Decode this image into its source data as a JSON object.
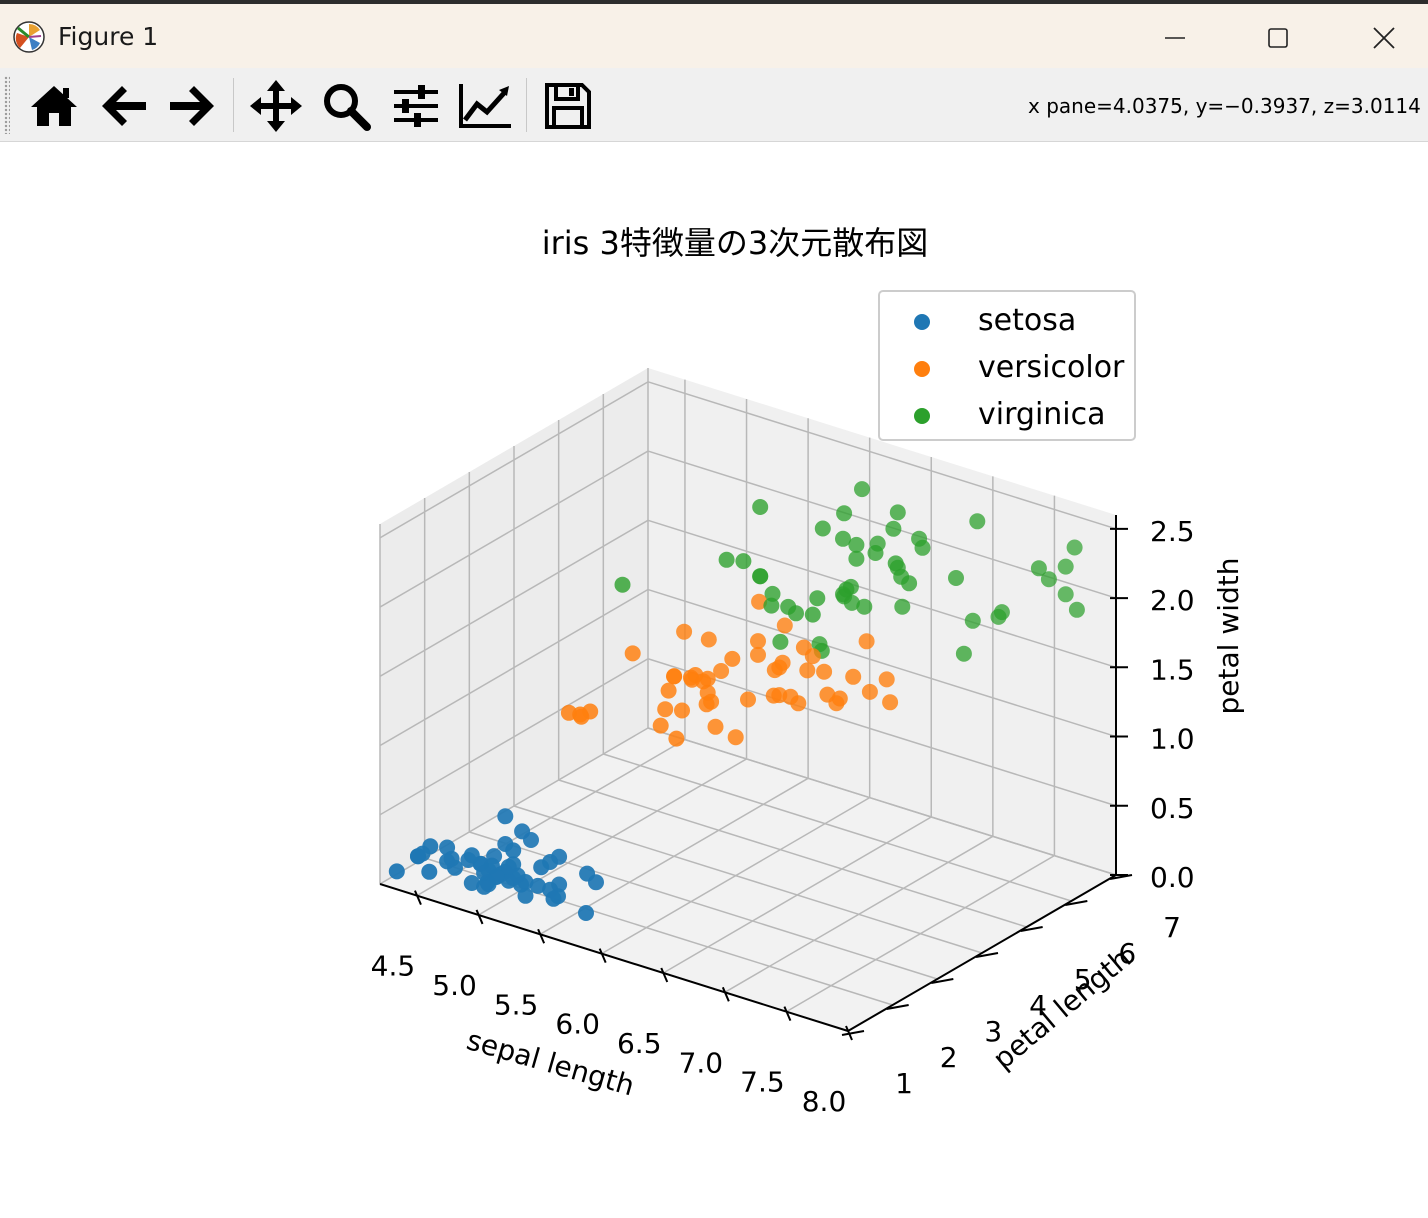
{
  "window": {
    "title": "Figure 1"
  },
  "icons": {
    "app": "matplotlib-logo-icon",
    "minimize": "minimize-icon",
    "maximize": "maximize-icon",
    "close": "close-icon"
  },
  "toolbar": {
    "buttons": [
      {
        "icon": "home-icon"
      },
      {
        "icon": "back-arrow-icon"
      },
      {
        "icon": "forward-arrow-icon"
      },
      {
        "icon": "pan-icon"
      },
      {
        "icon": "zoom-icon"
      },
      {
        "icon": "subplots-config-icon"
      },
      {
        "icon": "edit-axes-icon"
      },
      {
        "icon": "save-icon"
      }
    ],
    "coords": "x pane=4.0375, y=−0.3937, z=3.0114"
  },
  "chart_data": {
    "type": "scatter",
    "projection": "3d",
    "title": "iris 3特徴量の3次元散布図",
    "xlabel": "sepal length",
    "ylabel": "petal length",
    "zlabel": "petal width",
    "xlim": [
      4.2,
      8.0
    ],
    "ylim": [
      1.0,
      7.0
    ],
    "zlim": [
      0.0,
      2.6
    ],
    "xticks": [
      "4.5",
      "5.0",
      "5.5",
      "6.0",
      "6.5",
      "7.0",
      "7.5",
      "8.0"
    ],
    "yticks": [
      "1",
      "2",
      "3",
      "4",
      "5",
      "6",
      "7"
    ],
    "zticks": [
      "0.0",
      "0.5",
      "1.0",
      "1.5",
      "2.0",
      "2.5"
    ],
    "grid": true,
    "legend_position": "top-right",
    "series": [
      {
        "name": "setosa",
        "color": "#1f77b4",
        "points": [
          [
            5.1,
            1.4,
            0.2
          ],
          [
            4.9,
            1.4,
            0.2
          ],
          [
            4.7,
            1.3,
            0.2
          ],
          [
            4.6,
            1.5,
            0.2
          ],
          [
            5.0,
            1.4,
            0.2
          ],
          [
            5.4,
            1.7,
            0.4
          ],
          [
            4.6,
            1.4,
            0.3
          ],
          [
            5.0,
            1.5,
            0.2
          ],
          [
            4.4,
            1.4,
            0.2
          ],
          [
            4.9,
            1.5,
            0.1
          ],
          [
            5.4,
            1.5,
            0.2
          ],
          [
            4.8,
            1.6,
            0.2
          ],
          [
            4.8,
            1.4,
            0.1
          ],
          [
            4.3,
            1.1,
            0.1
          ],
          [
            5.8,
            1.2,
            0.2
          ],
          [
            5.7,
            1.5,
            0.4
          ],
          [
            5.4,
            1.3,
            0.4
          ],
          [
            5.1,
            1.4,
            0.3
          ],
          [
            5.7,
            1.7,
            0.3
          ],
          [
            5.1,
            1.5,
            0.3
          ],
          [
            5.4,
            1.7,
            0.2
          ],
          [
            5.1,
            1.5,
            0.4
          ],
          [
            4.6,
            1.0,
            0.2
          ],
          [
            5.1,
            1.7,
            0.5
          ],
          [
            4.8,
            1.9,
            0.2
          ],
          [
            5.0,
            1.6,
            0.2
          ],
          [
            5.0,
            1.6,
            0.4
          ],
          [
            5.2,
            1.5,
            0.2
          ],
          [
            5.2,
            1.4,
            0.2
          ],
          [
            4.7,
            1.6,
            0.2
          ],
          [
            4.8,
            1.6,
            0.2
          ],
          [
            5.4,
            1.5,
            0.4
          ],
          [
            5.2,
            1.5,
            0.1
          ],
          [
            5.5,
            1.4,
            0.2
          ],
          [
            4.9,
            1.5,
            0.2
          ],
          [
            5.0,
            1.2,
            0.2
          ],
          [
            5.5,
            1.3,
            0.2
          ],
          [
            4.9,
            1.4,
            0.1
          ],
          [
            4.4,
            1.3,
            0.2
          ],
          [
            5.1,
            1.5,
            0.2
          ],
          [
            5.0,
            1.3,
            0.3
          ],
          [
            4.5,
            1.3,
            0.3
          ],
          [
            4.4,
            1.3,
            0.2
          ],
          [
            5.0,
            1.6,
            0.6
          ],
          [
            5.1,
            1.9,
            0.4
          ],
          [
            4.8,
            1.4,
            0.3
          ],
          [
            5.1,
            1.6,
            0.2
          ],
          [
            4.6,
            1.4,
            0.2
          ],
          [
            5.3,
            1.5,
            0.2
          ],
          [
            5.0,
            1.4,
            0.2
          ]
        ]
      },
      {
        "name": "versicolor",
        "color": "#ff7f0e",
        "points": [
          [
            7.0,
            4.7,
            1.4
          ],
          [
            6.4,
            4.5,
            1.5
          ],
          [
            6.9,
            4.9,
            1.5
          ],
          [
            5.5,
            4.0,
            1.3
          ],
          [
            6.5,
            4.6,
            1.5
          ],
          [
            5.7,
            4.5,
            1.3
          ],
          [
            6.3,
            4.7,
            1.6
          ],
          [
            4.9,
            3.3,
            1.0
          ],
          [
            6.6,
            4.6,
            1.3
          ],
          [
            5.2,
            3.9,
            1.4
          ],
          [
            5.0,
            3.5,
            1.0
          ],
          [
            5.9,
            4.2,
            1.5
          ],
          [
            6.0,
            4.0,
            1.0
          ],
          [
            6.1,
            4.7,
            1.4
          ],
          [
            5.6,
            3.6,
            1.3
          ],
          [
            6.7,
            4.4,
            1.4
          ],
          [
            5.6,
            4.5,
            1.5
          ],
          [
            5.8,
            4.1,
            1.0
          ],
          [
            6.2,
            4.5,
            1.5
          ],
          [
            5.6,
            3.9,
            1.1
          ],
          [
            5.9,
            4.8,
            1.8
          ],
          [
            6.1,
            4.0,
            1.3
          ],
          [
            6.3,
            4.9,
            1.5
          ],
          [
            6.1,
            4.7,
            1.2
          ],
          [
            6.4,
            4.3,
            1.3
          ],
          [
            6.6,
            4.4,
            1.4
          ],
          [
            6.8,
            4.8,
            1.4
          ],
          [
            6.7,
            5.0,
            1.7
          ],
          [
            6.0,
            4.5,
            1.5
          ],
          [
            5.7,
            3.5,
            1.0
          ],
          [
            5.5,
            3.8,
            1.1
          ],
          [
            5.5,
            3.7,
            1.0
          ],
          [
            5.8,
            3.9,
            1.2
          ],
          [
            6.0,
            5.1,
            1.6
          ],
          [
            5.4,
            4.5,
            1.5
          ],
          [
            6.0,
            4.5,
            1.6
          ],
          [
            6.7,
            4.7,
            1.5
          ],
          [
            6.3,
            4.4,
            1.3
          ],
          [
            5.6,
            4.1,
            1.3
          ],
          [
            5.5,
            4.0,
            1.3
          ],
          [
            5.5,
            4.4,
            1.2
          ],
          [
            6.1,
            4.6,
            1.4
          ],
          [
            5.8,
            4.0,
            1.2
          ],
          [
            5.0,
            3.3,
            1.0
          ],
          [
            5.6,
            4.2,
            1.3
          ],
          [
            5.7,
            4.2,
            1.2
          ],
          [
            5.7,
            4.2,
            1.3
          ],
          [
            6.2,
            4.3,
            1.3
          ],
          [
            5.1,
            3.0,
            1.1
          ],
          [
            5.7,
            4.1,
            1.3
          ]
        ]
      },
      {
        "name": "virginica",
        "color": "#2ca02c",
        "points": [
          [
            6.3,
            6.0,
            2.5
          ],
          [
            5.8,
            5.1,
            1.9
          ],
          [
            7.1,
            5.9,
            2.1
          ],
          [
            6.3,
            5.6,
            1.8
          ],
          [
            6.5,
            5.8,
            2.2
          ],
          [
            7.6,
            6.6,
            2.1
          ],
          [
            4.9,
            4.5,
            1.7
          ],
          [
            7.3,
            6.3,
            1.8
          ],
          [
            6.7,
            5.8,
            1.8
          ],
          [
            7.2,
            6.1,
            2.5
          ],
          [
            6.5,
            5.1,
            2.0
          ],
          [
            6.4,
            5.3,
            1.9
          ],
          [
            6.8,
            5.5,
            2.1
          ],
          [
            5.7,
            5.0,
            2.0
          ],
          [
            5.8,
            5.1,
            2.4
          ],
          [
            6.4,
            5.3,
            2.3
          ],
          [
            6.5,
            5.5,
            1.8
          ],
          [
            7.7,
            6.7,
            2.2
          ],
          [
            7.7,
            6.9,
            2.3
          ],
          [
            6.0,
            5.0,
            1.5
          ],
          [
            6.9,
            5.7,
            2.3
          ],
          [
            5.6,
            4.9,
            2.0
          ],
          [
            7.7,
            6.7,
            2.0
          ],
          [
            6.3,
            4.9,
            1.8
          ],
          [
            6.7,
            5.7,
            2.1
          ],
          [
            7.2,
            6.0,
            1.8
          ],
          [
            6.2,
            4.8,
            1.8
          ],
          [
            6.1,
            4.9,
            1.8
          ],
          [
            6.4,
            5.6,
            2.1
          ],
          [
            7.2,
            5.8,
            1.6
          ],
          [
            7.4,
            6.1,
            1.9
          ],
          [
            7.9,
            6.4,
            2.0
          ],
          [
            6.4,
            5.6,
            2.2
          ],
          [
            6.3,
            5.1,
            1.5
          ],
          [
            6.1,
            5.6,
            1.4
          ],
          [
            7.7,
            6.1,
            2.3
          ],
          [
            6.3,
            5.6,
            2.4
          ],
          [
            6.4,
            5.5,
            1.8
          ],
          [
            6.0,
            4.8,
            1.8
          ],
          [
            6.9,
            5.4,
            2.1
          ],
          [
            6.7,
            5.6,
            2.4
          ],
          [
            6.9,
            5.1,
            2.3
          ],
          [
            5.8,
            5.1,
            1.9
          ],
          [
            6.8,
            5.9,
            2.3
          ],
          [
            6.7,
            5.7,
            2.5
          ],
          [
            6.7,
            5.2,
            2.3
          ],
          [
            6.3,
            5.0,
            1.9
          ],
          [
            6.5,
            5.2,
            2.0
          ],
          [
            6.2,
            5.4,
            2.3
          ],
          [
            5.9,
            5.1,
            1.8
          ]
        ]
      }
    ]
  }
}
